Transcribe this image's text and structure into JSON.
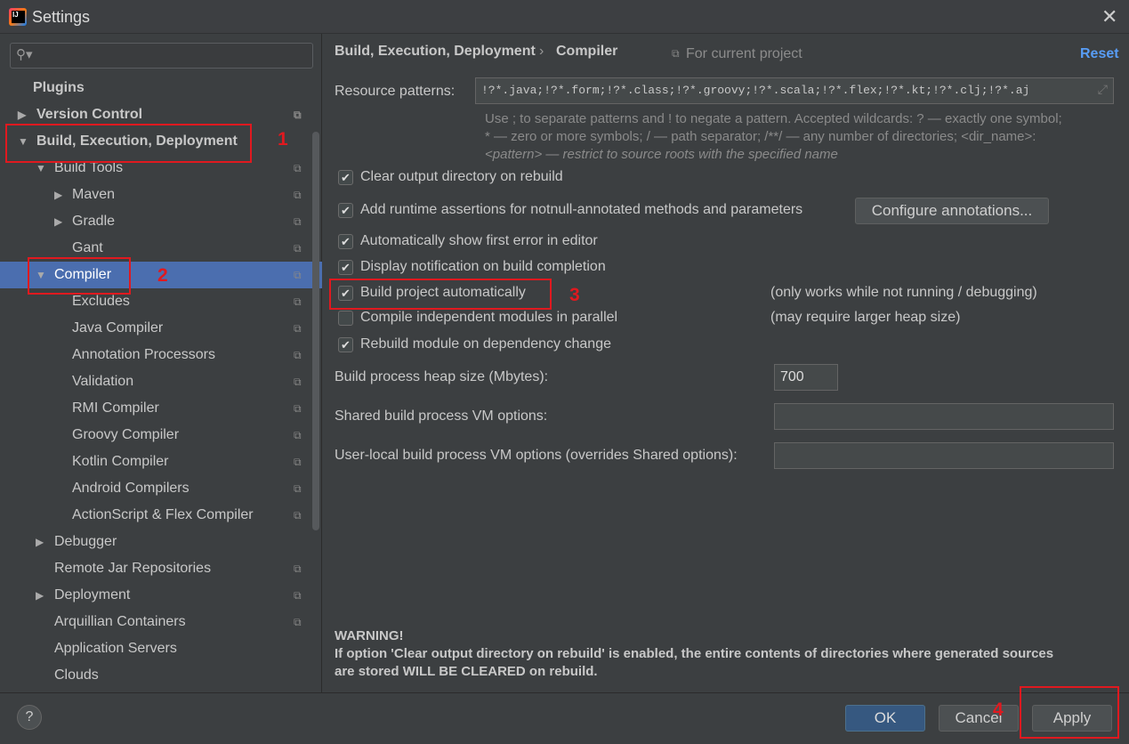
{
  "window": {
    "title": "Settings",
    "close_icon": "close-icon"
  },
  "search": {
    "placeholder": ""
  },
  "tree": [
    {
      "label": "Plugins",
      "level": 0,
      "arrow": "",
      "bold": true,
      "copy": false
    },
    {
      "label": "Version Control",
      "level": 0,
      "arrow": "▶",
      "bold": true,
      "copy": true
    },
    {
      "label": "Build, Execution, Deployment",
      "level": 0,
      "arrow": "▼",
      "bold": true,
      "copy": false
    },
    {
      "label": "Build Tools",
      "level": 1,
      "arrow": "▼",
      "copy": true
    },
    {
      "label": "Maven",
      "level": 2,
      "arrow": "▶",
      "copy": true
    },
    {
      "label": "Gradle",
      "level": 2,
      "arrow": "▶",
      "copy": true
    },
    {
      "label": "Gant",
      "level": 2,
      "arrow": "",
      "copy": true
    },
    {
      "label": "Compiler",
      "level": 1,
      "arrow": "▼",
      "copy": true,
      "selected": true
    },
    {
      "label": "Excludes",
      "level": 2,
      "arrow": "",
      "copy": true
    },
    {
      "label": "Java Compiler",
      "level": 2,
      "arrow": "",
      "copy": true
    },
    {
      "label": "Annotation Processors",
      "level": 2,
      "arrow": "",
      "copy": true
    },
    {
      "label": "Validation",
      "level": 2,
      "arrow": "",
      "copy": true
    },
    {
      "label": "RMI Compiler",
      "level": 2,
      "arrow": "",
      "copy": true
    },
    {
      "label": "Groovy Compiler",
      "level": 2,
      "arrow": "",
      "copy": true
    },
    {
      "label": "Kotlin Compiler",
      "level": 2,
      "arrow": "",
      "copy": true
    },
    {
      "label": "Android Compilers",
      "level": 2,
      "arrow": "",
      "copy": true
    },
    {
      "label": "ActionScript & Flex Compiler",
      "level": 2,
      "arrow": "",
      "copy": true
    },
    {
      "label": "Debugger",
      "level": 1,
      "arrow": "▶",
      "copy": false
    },
    {
      "label": "Remote Jar Repositories",
      "level": 1,
      "arrow": "",
      "copy": true
    },
    {
      "label": "Deployment",
      "level": 1,
      "arrow": "▶",
      "copy": true
    },
    {
      "label": "Arquillian Containers",
      "level": 1,
      "arrow": "",
      "copy": true
    },
    {
      "label": "Application Servers",
      "level": 1,
      "arrow": "",
      "copy": false
    },
    {
      "label": "Clouds",
      "level": 1,
      "arrow": "",
      "copy": false
    }
  ],
  "breadcrumb": {
    "parent": "Build, Execution, Deployment",
    "sep": "›",
    "current": "Compiler",
    "scope": "For current project",
    "reset": "Reset"
  },
  "resource": {
    "label": "Resource patterns:",
    "value": "!?*.java;!?*.form;!?*.class;!?*.groovy;!?*.scala;!?*.flex;!?*.kt;!?*.clj;!?*.aj",
    "hint1": "Use ; to separate patterns and ! to negate a pattern. Accepted wildcards: ? — exactly one symbol;",
    "hint2": "* — zero or more symbols; / — path separator; /**/ — any number of directories; <dir_name>:",
    "hint3": "<pattern> — restrict to source roots with the specified name"
  },
  "options": [
    {
      "label": "Clear output directory on rebuild",
      "checked": true
    },
    {
      "label": "Add runtime assertions for notnull-annotated methods and parameters",
      "checked": true
    },
    {
      "label": "Automatically show first error in editor",
      "checked": true
    },
    {
      "label": "Display notification on build completion",
      "checked": true
    },
    {
      "label": "Build project automatically",
      "checked": true,
      "note": "(only works while not running / debugging)"
    },
    {
      "label": "Compile independent modules in parallel",
      "checked": false,
      "note": "(may require larger heap size)"
    },
    {
      "label": "Rebuild module on dependency change",
      "checked": true
    }
  ],
  "configure_button": "Configure annotations...",
  "heap": {
    "label": "Build process heap size (Mbytes):",
    "value": "700"
  },
  "shared_vm": {
    "label": "Shared build process VM options:",
    "value": ""
  },
  "local_vm": {
    "label": "User-local build process VM options (overrides Shared options):",
    "value": ""
  },
  "warning": {
    "title": "WARNING!",
    "line1": "If option 'Clear output directory on rebuild' is enabled, the entire contents of directories where generated sources",
    "line2": "are stored WILL BE CLEARED on rebuild."
  },
  "footer": {
    "help": "?",
    "ok": "OK",
    "cancel": "Cancel",
    "apply": "Apply"
  },
  "annotations": {
    "n1": "1",
    "n2": "2",
    "n3": "3",
    "n4": "4",
    "color": "#e0191f"
  }
}
